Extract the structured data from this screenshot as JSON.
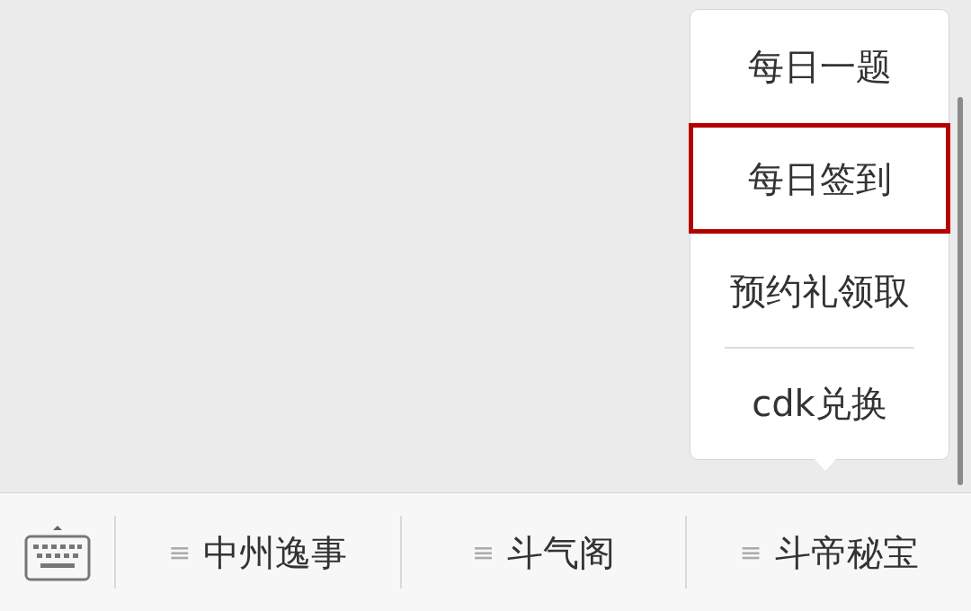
{
  "popup_menu": {
    "items": [
      {
        "label": "每日一题",
        "highlighted": false,
        "separated": false
      },
      {
        "label": "每日签到",
        "highlighted": true,
        "separated": false
      },
      {
        "label": "预约礼领取",
        "highlighted": false,
        "separated": false
      },
      {
        "label": "cdk兑换",
        "highlighted": false,
        "separated": true
      }
    ]
  },
  "bottom_menu": {
    "items": [
      {
        "icon": "≡",
        "label": "中州逸事"
      },
      {
        "icon": "≡",
        "label": "斗气阁"
      },
      {
        "icon": "≡",
        "label": "斗帝秘宝"
      }
    ]
  }
}
